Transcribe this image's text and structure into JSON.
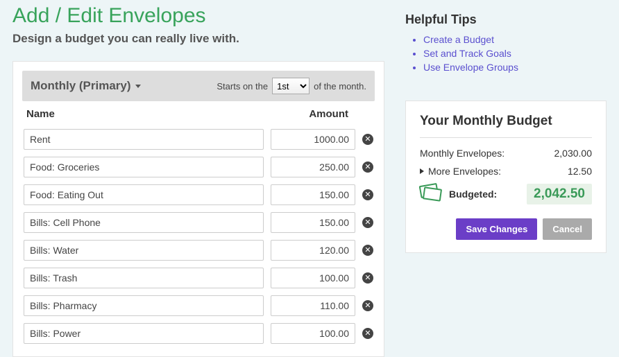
{
  "page": {
    "title": "Add / Edit Envelopes",
    "subtitle": "Design a budget you can really live with."
  },
  "section": {
    "heading": "Monthly (Primary)",
    "starts_prefix": "Starts on the",
    "starts_suffix": "of the month.",
    "day_selected": "1st",
    "col_name": "Name",
    "col_amount": "Amount"
  },
  "envelopes": [
    {
      "name": "Rent",
      "amount": "1000.00"
    },
    {
      "name": "Food: Groceries",
      "amount": "250.00"
    },
    {
      "name": "Food: Eating Out",
      "amount": "150.00"
    },
    {
      "name": "Bills: Cell Phone",
      "amount": "150.00"
    },
    {
      "name": "Bills: Water",
      "amount": "120.00"
    },
    {
      "name": "Bills: Trash",
      "amount": "100.00"
    },
    {
      "name": "Bills: Pharmacy",
      "amount": "110.00"
    },
    {
      "name": "Bills: Power",
      "amount": "100.00"
    }
  ],
  "tips": {
    "heading": "Helpful Tips",
    "items": [
      "Create a Budget",
      "Set and Track Goals",
      "Use Envelope Groups"
    ]
  },
  "budget": {
    "heading": "Your Monthly Budget",
    "monthly_label": "Monthly Envelopes:",
    "monthly_value": "2,030.00",
    "more_label": "More Envelopes:",
    "more_value": "12.50",
    "budgeted_label": "Budgeted:",
    "budgeted_value": "2,042.50",
    "save_label": "Save Changes",
    "cancel_label": "Cancel"
  }
}
